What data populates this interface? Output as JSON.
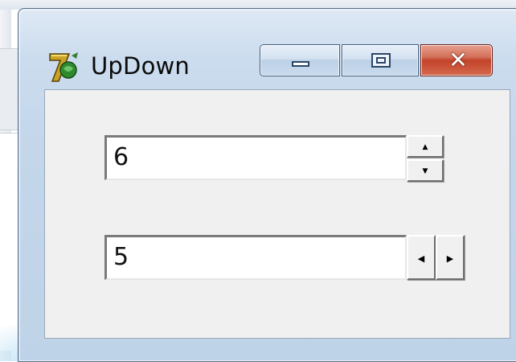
{
  "window": {
    "title": "UpDown",
    "app_icon": "delphi-7-icon"
  },
  "caption_buttons": {
    "minimize_icon": "minimize-icon",
    "maximize_icon": "maximize-icon",
    "close_glyph": "✕"
  },
  "updown_vertical": {
    "value": "6",
    "up_glyph": "▲",
    "down_glyph": "▼"
  },
  "updown_horizontal": {
    "value": "5",
    "left_glyph": "◀",
    "right_glyph": "▶"
  },
  "colors": {
    "close_button": "#c2432a",
    "client_area": "#f0f0f0"
  }
}
